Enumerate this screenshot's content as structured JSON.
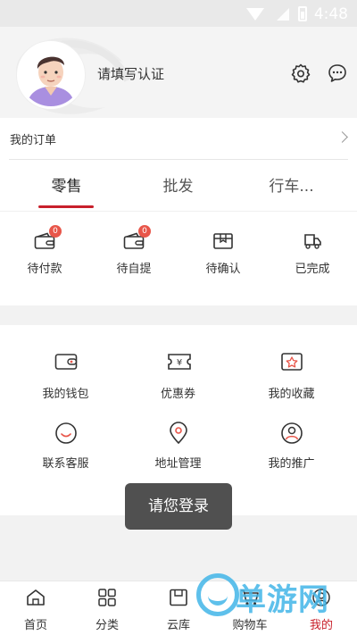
{
  "status_bar": {
    "time": "4:48"
  },
  "profile": {
    "name": "请填写认证"
  },
  "orders": {
    "title": "我的订单",
    "tabs": [
      {
        "label": "零售",
        "active": true
      },
      {
        "label": "批发",
        "active": false
      },
      {
        "label": "行车...",
        "active": false
      }
    ],
    "statuses": [
      {
        "label": "待付款",
        "icon": "wallet-icon",
        "badge": "0"
      },
      {
        "label": "待自提",
        "icon": "wallet-icon",
        "badge": "0"
      },
      {
        "label": "待确认",
        "icon": "box-icon",
        "badge": ""
      },
      {
        "label": "已完成",
        "icon": "truck-icon",
        "badge": ""
      }
    ]
  },
  "tools": [
    {
      "label": "我的钱包",
      "icon": "wallet-icon"
    },
    {
      "label": "优惠券",
      "icon": "coupon-icon"
    },
    {
      "label": "我的收藏",
      "icon": "favorite-icon"
    },
    {
      "label": "联系客服",
      "icon": "customer-service-icon"
    },
    {
      "label": "地址管理",
      "icon": "location-icon"
    },
    {
      "label": "我的推广",
      "icon": "promotion-icon"
    }
  ],
  "toast": "请您登录",
  "bottom_nav": [
    {
      "label": "首页",
      "icon": "home-icon"
    },
    {
      "label": "分类",
      "icon": "category-icon"
    },
    {
      "label": "云库",
      "icon": "cloud-store-icon"
    },
    {
      "label": "购物车",
      "icon": "cart-icon"
    },
    {
      "label": "我的",
      "icon": "user-icon",
      "active": true
    }
  ],
  "watermark": "单游网",
  "colors": {
    "accent": "#c8202b",
    "badge": "#e8564a",
    "watermark": "#43b6e8"
  }
}
